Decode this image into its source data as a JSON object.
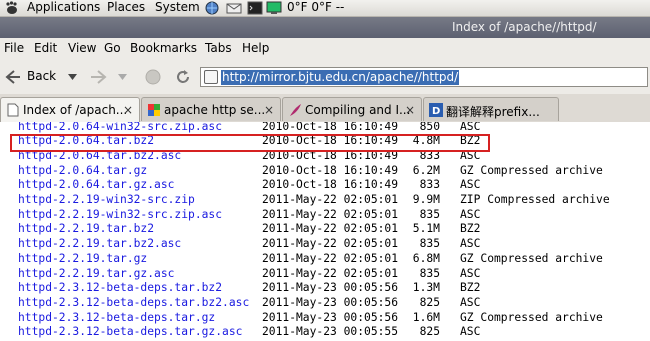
{
  "panel": {
    "menus": [
      "Applications",
      "Places",
      "System"
    ],
    "weather": "0°F 0°F --"
  },
  "window": {
    "title": "Index of /apache//httpd/"
  },
  "menubar": [
    "File",
    "Edit",
    "View",
    "Go",
    "Bookmarks",
    "Tabs",
    "Help"
  ],
  "toolbar": {
    "back_label": "Back",
    "url": "http://mirror.bjtu.edu.cn/apache//httpd/"
  },
  "tabs": [
    {
      "label": "Index of /apach...",
      "active": true,
      "icon": "page-icon",
      "close": "×"
    },
    {
      "label": "apache http se...",
      "active": false,
      "icon": "google-icon",
      "close": "×"
    },
    {
      "label": "Compiling and I...",
      "active": false,
      "icon": "feather-icon",
      "close": "×"
    },
    {
      "label": "翻译解释prefix...",
      "active": false,
      "icon": "dict-icon",
      "close": ""
    }
  ],
  "listing": [
    {
      "name": "httpd-2.0.64-win32-src.zip.asc",
      "date": "2010-Oct-18 16:10:49",
      "size": "850",
      "desc": "ASC"
    },
    {
      "name": "httpd-2.0.64.tar.bz2",
      "date": "2010-Oct-18 16:10:49",
      "size": "4.8M",
      "desc": "BZ2"
    },
    {
      "name": "httpd-2.0.64.tar.bz2.asc",
      "date": "2010-Oct-18 16:10:49",
      "size": "833",
      "desc": "ASC"
    },
    {
      "name": "httpd-2.0.64.tar.gz",
      "date": "2010-Oct-18 16:10:49",
      "size": "6.2M",
      "desc": "GZ Compressed archive"
    },
    {
      "name": "httpd-2.0.64.tar.gz.asc",
      "date": "2010-Oct-18 16:10:49",
      "size": "833",
      "desc": "ASC"
    },
    {
      "name": "httpd-2.2.19-win32-src.zip",
      "date": "2011-May-22 02:05:01",
      "size": "9.9M",
      "desc": "ZIP Compressed archive"
    },
    {
      "name": "httpd-2.2.19-win32-src.zip.asc",
      "date": "2011-May-22 02:05:01",
      "size": "835",
      "desc": "ASC"
    },
    {
      "name": "httpd-2.2.19.tar.bz2",
      "date": "2011-May-22 02:05:01",
      "size": "5.1M",
      "desc": "BZ2"
    },
    {
      "name": "httpd-2.2.19.tar.bz2.asc",
      "date": "2011-May-22 02:05:01",
      "size": "835",
      "desc": "ASC"
    },
    {
      "name": "httpd-2.2.19.tar.gz",
      "date": "2011-May-22 02:05:01",
      "size": "6.8M",
      "desc": "GZ Compressed archive"
    },
    {
      "name": "httpd-2.2.19.tar.gz.asc",
      "date": "2011-May-22 02:05:01",
      "size": "835",
      "desc": "ASC"
    },
    {
      "name": "httpd-2.3.12-beta-deps.tar.bz2",
      "date": "2011-May-23 00:05:56",
      "size": "1.3M",
      "desc": "BZ2"
    },
    {
      "name": "httpd-2.3.12-beta-deps.tar.bz2.asc",
      "date": "2011-May-23 00:05:56",
      "size": "825",
      "desc": "ASC"
    },
    {
      "name": "httpd-2.3.12-beta-deps.tar.gz",
      "date": "2011-May-23 00:05:56",
      "size": "1.6M",
      "desc": "GZ Compressed archive"
    },
    {
      "name": "httpd-2.3.12-beta-deps.tar.gz.asc",
      "date": "2011-May-23 00:05:55",
      "size": "825",
      "desc": "ASC"
    }
  ],
  "colors": {
    "link": "#1a1ae0",
    "highlight": "#d62121",
    "url_selection": "#3b6db3",
    "titlebar": "#5c6070"
  }
}
